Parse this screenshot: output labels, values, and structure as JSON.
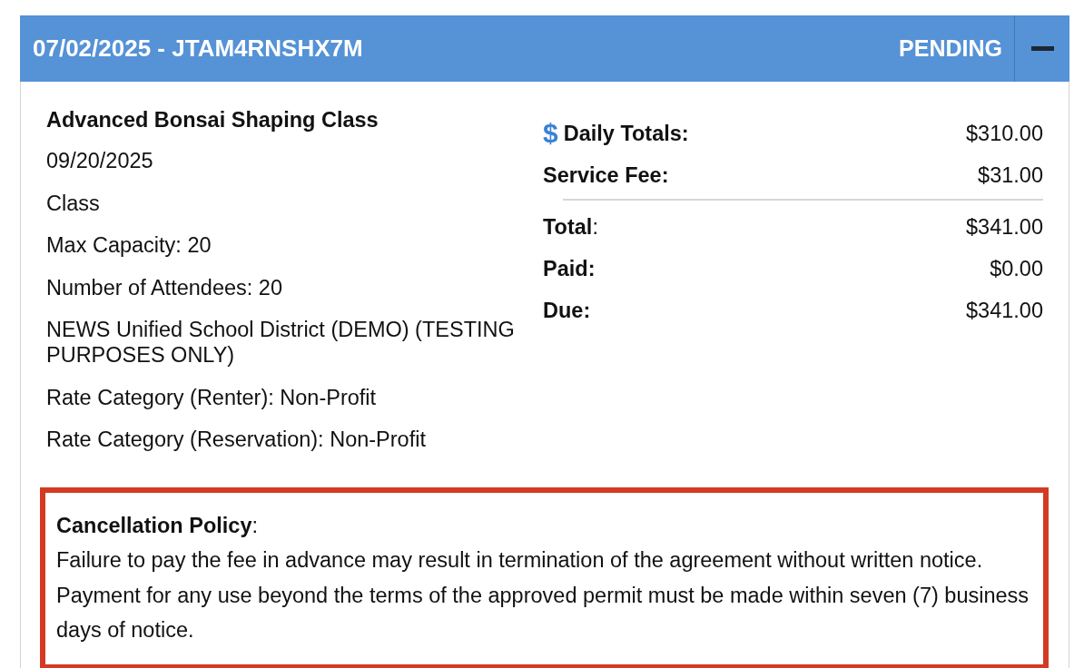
{
  "header": {
    "title": "07/02/2025 - JTAM4RNSHX7M",
    "status": "PENDING",
    "expanded": true
  },
  "details": {
    "name": "Advanced Bonsai Shaping Class",
    "lines": [
      "09/20/2025",
      "Class",
      "Max Capacity: 20",
      "Number of Attendees: 20",
      "NEWS Unified School District (DEMO) (TESTING PURPOSES ONLY)",
      "Rate Category (Renter): Non-Profit",
      "Rate Category (Reservation): Non-Profit"
    ]
  },
  "charges": [
    {
      "icon": "$",
      "label": "**Daily Totals:**",
      "amount": "$310.00"
    },
    {
      "label": "**Service Fee:**",
      "amount": "$31.00"
    }
  ],
  "totals": [
    {
      "label": "**Total**:",
      "amount": "$341.00"
    },
    {
      "label": "**Paid:**",
      "amount": "$0.00"
    },
    {
      "label": "**Due:**",
      "amount": "$341.00"
    }
  ],
  "policy": {
    "title": "**Cancellation Policy**:",
    "text": "Failure to pay the fee in advance may result in termination of the agreement without written notice. Payment for any use beyond the terms of the approved permit must be made within seven (7) business days of notice."
  }
}
